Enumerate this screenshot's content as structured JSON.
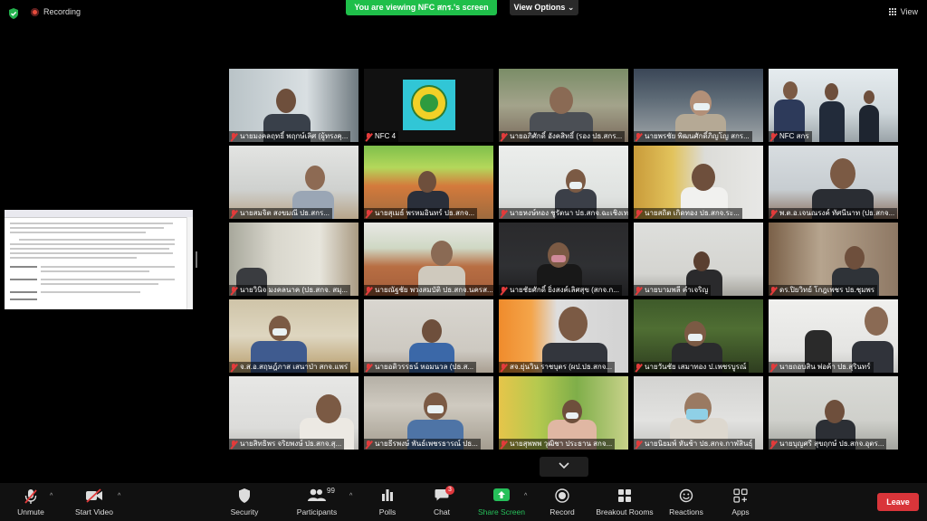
{
  "top_bar": {
    "recording_label": "Recording",
    "viewing_banner": "You are viewing NFC สกร.'s screen",
    "view_options_label": "View Options",
    "view_label": "View"
  },
  "participants": [
    {
      "name": "นายมงคลฤทธิ์ พฤกษ์เลิศ (ผู้ทรงคุ..."
    },
    {
      "name": "NFC 4"
    },
    {
      "name": "นายอภิศักดิ์ อังคสิทธิ์ (รอง ปธ.สกร..."
    },
    {
      "name": "นายพรชัย พิฒนศักดิ์ภิญโญ สกร..."
    },
    {
      "name": "NFC สกร"
    },
    {
      "name": "นายสมจิต สงขมณี ปธ.สกร..."
    },
    {
      "name": "นายสุเมธ์ พรหมอินทร์ ปธ.สกจ..."
    },
    {
      "name": "นายหงษ์ทอง ชูรัตนา ปธ.สกจ.ฉะเชิงเทรา"
    },
    {
      "name": "นายสถิต เกิดทอง ปธ.สกจ.ระ..."
    },
    {
      "name": "พ.ต.อ.เจนณรงค์ ทัศนีนาท (ปธ.สกจ..."
    },
    {
      "name": "นายวินิจ มงคลนาค (ปธ.สกจ. สมุ..."
    },
    {
      "name": "นายณัฐชัย พวงสมบัติ ปธ.สกจ.นครส..."
    },
    {
      "name": "นายชัยศักดิ์ ยิ่งสงค์เลิศสุข (สกจ.ก..."
    },
    {
      "name": "นายบามพลี คำเจริญ"
    },
    {
      "name": "ดร.ปิยวิทย์ โกฎเพชร ปธ.ชุมพร"
    },
    {
      "name": "จ.ส.อ.สฤษฎ์ภาส เสนาป่า สกจ.แพร่"
    },
    {
      "name": "นายอดิวรรธน์ หอมนวล (ปธ.ส..."
    },
    {
      "name": "สจ.ยุ่นวิน ราชบุตร (ผป.ปธ.สกจ..."
    },
    {
      "name": "นายวันชัย เสมาทอง ป.เพชรบูรณ์"
    },
    {
      "name": "นายถอบสิน พ่อค้า ปธ.สุรินทร์"
    },
    {
      "name": "นายสิทธิพร จริยพงษ์ ปธ.สกจ.สุ..."
    },
    {
      "name": "นายธีรพงษ์ พันธ์เพชรธารณ์ ปธ..."
    },
    {
      "name": "นายสุพพพ วุฒิชา ประธาน สกจ..."
    },
    {
      "name": "นายนิยมพ์ หันช้า ปธ.สกจ.กาฬสินธุ์"
    },
    {
      "name": "นายบุญศรี สุขฤกษ์ ปธ.สกจ.อุตร..."
    }
  ],
  "toolbar": {
    "unmute": "Unmute",
    "start_video": "Start Video",
    "security": "Security",
    "participants": "Participants",
    "participants_count": "99",
    "polls": "Polls",
    "chat": "Chat",
    "chat_badge": "3",
    "share_screen": "Share Screen",
    "record": "Record",
    "breakout_rooms": "Breakout Rooms",
    "reactions": "Reactions",
    "apps": "Apps",
    "leave": "Leave"
  },
  "colors": {
    "viewing_banner": "#1fbf4a",
    "active_speaker_border": "#d6e34c",
    "leave_button": "#d9353a",
    "share_screen": "#26c05a"
  }
}
